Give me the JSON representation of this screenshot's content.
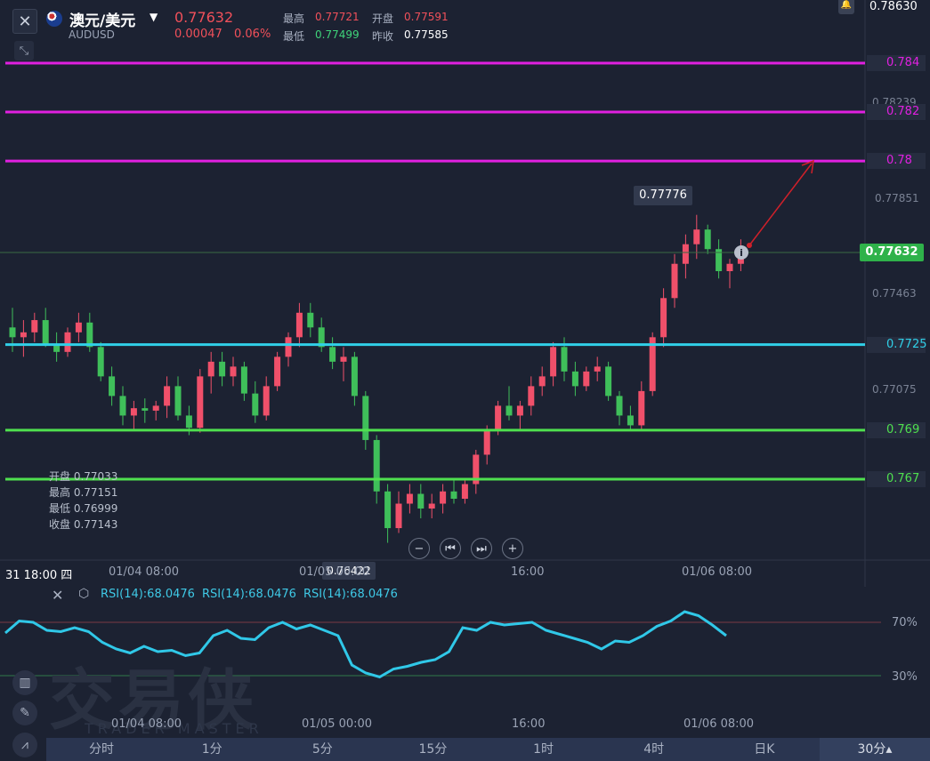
{
  "header": {
    "pair_name": "澳元/美元",
    "symbol": "AUDUSD",
    "price": "0.77632",
    "change": "0.00047",
    "change_pct": "0.06%",
    "high_label": "最高",
    "high": "0.77721",
    "open_label": "开盘",
    "open": "0.77591",
    "low_label": "最低",
    "low": "0.77499",
    "prev_label": "昨收",
    "prev": "0.77585"
  },
  "price_axis": {
    "top_value": "0.78630",
    "ticks": [
      "0.78239",
      "0.77851",
      "0.77463",
      "0.77075"
    ],
    "current_price_tag": "0.77632"
  },
  "levels": [
    {
      "label": "0.784",
      "price": 0.784,
      "color": "#e020e0"
    },
    {
      "label": "0.782",
      "price": 0.782,
      "color": "#e020e0"
    },
    {
      "label": "0.78",
      "price": 0.78,
      "color": "#e020e0"
    },
    {
      "label": "0.7725",
      "price": 0.7725,
      "color": "#30d0e8"
    },
    {
      "label": "0.769",
      "price": 0.769,
      "color": "#4fe04f"
    },
    {
      "label": "0.767",
      "price": 0.767,
      "color": "#4fe04f"
    }
  ],
  "annotations": {
    "high_marker": "0.77776",
    "low_marker": "0.76422"
  },
  "ohlc_box": {
    "open": "开盘 0.77033",
    "high": "最高 0.77151",
    "low": "最低 0.76999",
    "close": "收盘 0.77143"
  },
  "time_axis": {
    "start": "31 18:00 四",
    "labels": [
      "01/04 08:00",
      "01/05 00:00",
      "16:00",
      "01/06 08:00"
    ]
  },
  "rsi": {
    "labels": [
      "RSI(14):68.0476",
      "RSI(14):68.0476",
      "RSI(14):68.0476"
    ],
    "levels": [
      "70%",
      "30%"
    ],
    "time_labels": [
      "01/04 08:00",
      "01/05 00:00",
      "16:00",
      "01/06 08:00"
    ],
    "values": [
      62,
      71,
      70,
      64,
      63,
      66,
      63,
      55,
      50,
      47,
      52,
      48,
      49,
      45,
      47,
      60,
      64,
      58,
      57,
      66,
      70,
      65,
      68,
      64,
      60,
      38,
      32,
      29,
      35,
      37,
      40,
      42,
      48,
      66,
      64,
      70,
      68,
      69,
      70,
      64,
      61,
      58,
      55,
      50,
      56,
      55,
      60,
      67,
      71,
      78,
      75,
      68,
      60
    ]
  },
  "candles_ohlc": [
    [
      0.7732,
      0.774,
      0.7722,
      0.7728
    ],
    [
      0.7728,
      0.7735,
      0.772,
      0.773
    ],
    [
      0.773,
      0.7738,
      0.7726,
      0.7735
    ],
    [
      0.7735,
      0.774,
      0.7724,
      0.7725
    ],
    [
      0.7725,
      0.773,
      0.7718,
      0.7722
    ],
    [
      0.7722,
      0.7732,
      0.772,
      0.773
    ],
    [
      0.773,
      0.7738,
      0.7726,
      0.7734
    ],
    [
      0.7734,
      0.7738,
      0.7722,
      0.7724
    ],
    [
      0.7724,
      0.7726,
      0.771,
      0.7712
    ],
    [
      0.7712,
      0.7716,
      0.77,
      0.7704
    ],
    [
      0.7704,
      0.7708,
      0.7692,
      0.7696
    ],
    [
      0.7696,
      0.7702,
      0.769,
      0.7699
    ],
    [
      0.7699,
      0.7703,
      0.7693,
      0.7698
    ],
    [
      0.7698,
      0.7702,
      0.7694,
      0.77
    ],
    [
      0.77,
      0.7712,
      0.7695,
      0.7708
    ],
    [
      0.7708,
      0.7712,
      0.7694,
      0.7696
    ],
    [
      0.7696,
      0.77,
      0.7688,
      0.7691
    ],
    [
      0.7691,
      0.7715,
      0.7689,
      0.7712
    ],
    [
      0.7712,
      0.7722,
      0.7705,
      0.7718
    ],
    [
      0.7718,
      0.7722,
      0.7708,
      0.7712
    ],
    [
      0.7712,
      0.772,
      0.7708,
      0.7716
    ],
    [
      0.7716,
      0.7718,
      0.7702,
      0.7705
    ],
    [
      0.7705,
      0.771,
      0.7693,
      0.7696
    ],
    [
      0.7696,
      0.7712,
      0.7694,
      0.7708
    ],
    [
      0.7708,
      0.7722,
      0.7706,
      0.772
    ],
    [
      0.772,
      0.773,
      0.7716,
      0.7728
    ],
    [
      0.7728,
      0.7742,
      0.7724,
      0.7738
    ],
    [
      0.7738,
      0.7742,
      0.7728,
      0.7732
    ],
    [
      0.7732,
      0.7736,
      0.7722,
      0.7724
    ],
    [
      0.7724,
      0.7728,
      0.7715,
      0.7718
    ],
    [
      0.7718,
      0.7724,
      0.771,
      0.772
    ],
    [
      0.772,
      0.7722,
      0.77,
      0.7704
    ],
    [
      0.7704,
      0.7706,
      0.7682,
      0.7686
    ],
    [
      0.7686,
      0.7688,
      0.766,
      0.7665
    ],
    [
      0.7665,
      0.7668,
      0.7644,
      0.765
    ],
    [
      0.765,
      0.7665,
      0.7648,
      0.766
    ],
    [
      0.766,
      0.7668,
      0.7656,
      0.7664
    ],
    [
      0.7664,
      0.7668,
      0.7654,
      0.7658
    ],
    [
      0.7658,
      0.7664,
      0.7654,
      0.766
    ],
    [
      0.766,
      0.7668,
      0.7656,
      0.7665
    ],
    [
      0.7665,
      0.767,
      0.766,
      0.7662
    ],
    [
      0.7662,
      0.767,
      0.766,
      0.7668
    ],
    [
      0.7668,
      0.7682,
      0.7664,
      0.768
    ],
    [
      0.768,
      0.7692,
      0.7676,
      0.769
    ],
    [
      0.769,
      0.7702,
      0.7688,
      0.77
    ],
    [
      0.77,
      0.7708,
      0.7694,
      0.7696
    ],
    [
      0.7696,
      0.7702,
      0.769,
      0.77
    ],
    [
      0.77,
      0.7712,
      0.7696,
      0.7708
    ],
    [
      0.7708,
      0.7716,
      0.7704,
      0.7712
    ],
    [
      0.7712,
      0.7726,
      0.7708,
      0.7724
    ],
    [
      0.7724,
      0.7728,
      0.771,
      0.7714
    ],
    [
      0.7714,
      0.7718,
      0.7704,
      0.7708
    ],
    [
      0.7708,
      0.7716,
      0.7706,
      0.7714
    ],
    [
      0.7714,
      0.772,
      0.771,
      0.7716
    ],
    [
      0.7716,
      0.7718,
      0.7702,
      0.7704
    ],
    [
      0.7704,
      0.7706,
      0.7692,
      0.7696
    ],
    [
      0.7696,
      0.77,
      0.769,
      0.7692
    ],
    [
      0.7692,
      0.771,
      0.769,
      0.7706
    ],
    [
      0.7706,
      0.773,
      0.7704,
      0.7728
    ],
    [
      0.7728,
      0.7748,
      0.7724,
      0.7744
    ],
    [
      0.7744,
      0.7762,
      0.774,
      0.7758
    ],
    [
      0.7758,
      0.777,
      0.7752,
      0.7766
    ],
    [
      0.7766,
      0.7778,
      0.776,
      0.7772
    ],
    [
      0.7772,
      0.7774,
      0.7762,
      0.7764
    ],
    [
      0.7764,
      0.7768,
      0.7752,
      0.7755
    ],
    [
      0.7755,
      0.776,
      0.7748,
      0.7758
    ],
    [
      0.7758,
      0.7768,
      0.7755,
      0.7763
    ]
  ],
  "controls": [
    "−",
    "⏮",
    "⏭",
    "+"
  ],
  "tabs": [
    "分时",
    "1分",
    "5分",
    "15分",
    "1时",
    "4时",
    "日K",
    "30分▴"
  ],
  "watermark": "交易侠",
  "watermark_sub": "TRADER MASTER"
}
